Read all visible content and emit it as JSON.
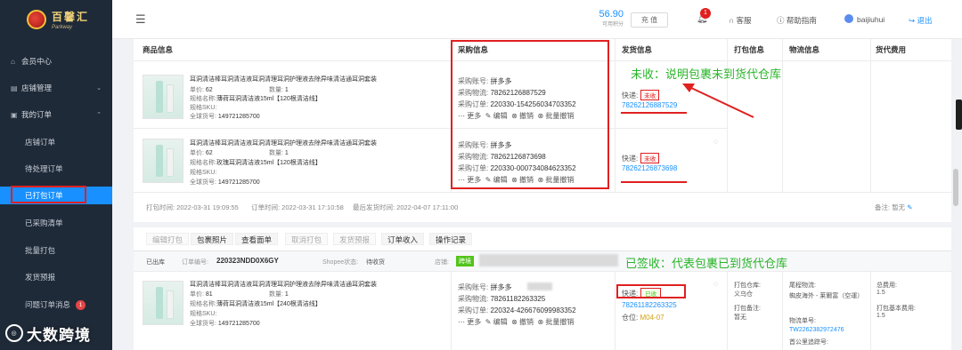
{
  "sidebar": {
    "logo_cn": "百馨汇",
    "logo_en": "Parkway",
    "items": [
      {
        "label": "会员中心"
      },
      {
        "label": "店铺管理"
      },
      {
        "label": "我的订单"
      }
    ],
    "sub_items": [
      {
        "label": "店铺订单"
      },
      {
        "label": "待处理订单"
      },
      {
        "label": "已打包订单"
      },
      {
        "label": "已采购清单"
      },
      {
        "label": "批量打包"
      },
      {
        "label": "发货预报"
      },
      {
        "label": "问题订单消息",
        "badge": "1"
      }
    ],
    "active_index": 2
  },
  "watermark": "大数跨境",
  "header": {
    "balance": "56.90",
    "balance_label": "可用积分",
    "recharge": "充 值",
    "notice_count": "1",
    "service": "客服",
    "help": "帮助指南",
    "username": "baijiuhui",
    "logout": "退出"
  },
  "table_headers": [
    "商品信息",
    "采购信息",
    "发货信息",
    "打包信息",
    "物流信息",
    "货代费用"
  ],
  "order1": {
    "items": [
      {
        "name": "耳洞清洁棒耳洞清洁液耳洞清理耳洞护理液去除异味清洁通耳洞套装",
        "price_label": "单价:",
        "price": "62",
        "qty_label": "数量:",
        "qty": "1",
        "spec_label": "规格名称:",
        "spec": "薄荷耳洞清洁液15ml【120根清洁线】",
        "sku_label": "规格SKU:",
        "gsku_label": "全球货号:",
        "gsku": "149721285700",
        "buyer_label": "采购账号:",
        "buyer": "拼多多",
        "logistics_label": "采购物流:",
        "logistics": "78262126887529",
        "porder_label": "采购订单:",
        "porder": "220330-154256034703352",
        "ship_label": "快递:",
        "ship_status": "未收",
        "tracking": "78262126887529"
      },
      {
        "name": "耳洞清洁棒耳洞清洁液耳洞清理耳洞护理液去除异味清洁通耳洞套装",
        "price_label": "单价:",
        "price": "62",
        "qty_label": "数量:",
        "qty": "1",
        "spec_label": "规格名称:",
        "spec": "玫瑰耳洞清洁液15ml【120根清洁线】",
        "sku_label": "规格SKU:",
        "gsku_label": "全球货号:",
        "gsku": "149721285700",
        "buyer_label": "采购账号:",
        "buyer": "拼多多",
        "logistics_label": "采购物流:",
        "logistics": "78262126873698",
        "porder_label": "采购订单:",
        "porder": "220330-000734084623352",
        "ship_label": "快递:",
        "ship_status": "未收",
        "tracking": "78262126873698"
      }
    ],
    "actions": {
      "more": "更多",
      "edit": "编辑",
      "cancel": "撤销",
      "batch_cancel": "批量撤销"
    },
    "meta_packed": "打包时间: 2022-03-31 19:09:55",
    "meta_ordered": "订单时间: 2022-03-31 17:10:58",
    "meta_latest": "最后发货时间: 2022-04-07 17:11:00",
    "remark_label": "备注:",
    "remark": "暂无"
  },
  "annotations": {
    "unreceived": "未收：说明包裹未到货代仓库",
    "signed": "已签收：代表包裹已到货代仓库"
  },
  "action_tabs": [
    "编辑打包",
    "包裹照片",
    "查看面单",
    "取消打包",
    "发货预报",
    "订单收入",
    "操作记录"
  ],
  "order2": {
    "status": "已出库",
    "order_no_label": "订单编号:",
    "order_no": "220323NDD0X6GY",
    "shopee_label": "Shopee状态:",
    "shopee_status": "待收货",
    "store_label": "店铺:",
    "store_tag": "跨境",
    "item": {
      "name": "耳洞清洁棒耳洞清洁液耳洞清理耳洞护理液去除异味清洁通耳洞套装",
      "price_label": "单价:",
      "price": "81",
      "qty_label": "数量:",
      "qty": "1",
      "spec_label": "规格名称:",
      "spec": "薄荷耳洞清洁液15ml【240根清洁线】",
      "sku_label": "规格SKU:",
      "gsku_label": "全球货号:",
      "gsku": "149721285700",
      "buyer_label": "采购账号:",
      "buyer": "拼多多",
      "logistics_label": "采购物流:",
      "logistics": "78261182263325",
      "porder_label": "采购订单:",
      "porder": "220324-426676099983352",
      "ship_label": "快递:",
      "ship_status": "已收",
      "tracking": "78261182263325",
      "warehouse_label": "仓位:",
      "warehouse": "M04-07"
    },
    "pack": {
      "wh_label": "打包仓库:",
      "wh": "义乌仓",
      "note_label": "打包备注:",
      "note": "暂无"
    },
    "logistics": {
      "label": "尾程物流:",
      "value": "蜘皮海外 - 莱爾富（空運）",
      "no_label": "物流单号:",
      "no": "TW2262382972476",
      "extra": "首公里追踪号:"
    },
    "fees": {
      "total_label": "总费用:",
      "total": "1.5",
      "basic_label": "打包基本费用:",
      "basic": "1.5"
    }
  }
}
